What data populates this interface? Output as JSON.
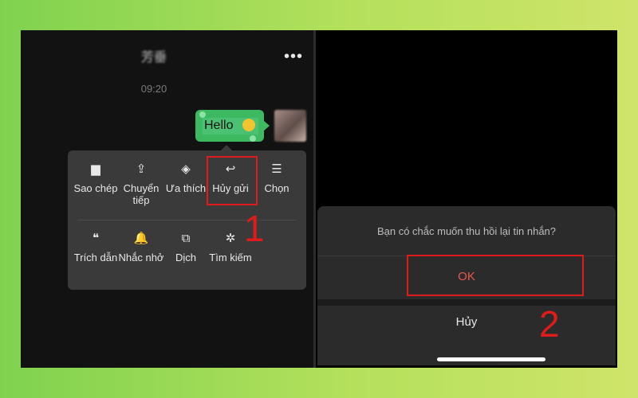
{
  "chat": {
    "title": "芳垂",
    "more_icon": "•••",
    "time": "09:20",
    "message": "Hello"
  },
  "context_menu": {
    "items": [
      {
        "label": "Sao chép",
        "icon": "document-icon",
        "glyph": "▆"
      },
      {
        "label": "Chuyển tiếp",
        "icon": "share-icon",
        "glyph": "⇪"
      },
      {
        "label": "Ưa thích",
        "icon": "cube-icon",
        "glyph": "◈"
      },
      {
        "label": "Hủy gửi",
        "icon": "undo-icon",
        "glyph": "↩"
      },
      {
        "label": "Chọn",
        "icon": "list-check-icon",
        "glyph": "☰"
      },
      {
        "label": "Trích dẫn",
        "icon": "quote-icon",
        "glyph": "❝"
      },
      {
        "label": "Nhắc nhở",
        "icon": "bell-icon",
        "glyph": "🔔"
      },
      {
        "label": "Dịch",
        "icon": "translate-icon",
        "glyph": "⧉"
      },
      {
        "label": "Tìm kiếm",
        "icon": "sparkle-search-icon",
        "glyph": "✲"
      }
    ]
  },
  "dialog": {
    "question": "Bạn có chắc muốn thu hồi lại tin nhắn?",
    "ok_label": "OK",
    "cancel_label": "Hủy"
  },
  "annotations": {
    "step1": "1",
    "step2": "2",
    "color": "#e01b1b"
  },
  "colors": {
    "bubble": "#3db961",
    "menu_bg": "#3a3a3a",
    "ok_text": "#e8574f"
  }
}
